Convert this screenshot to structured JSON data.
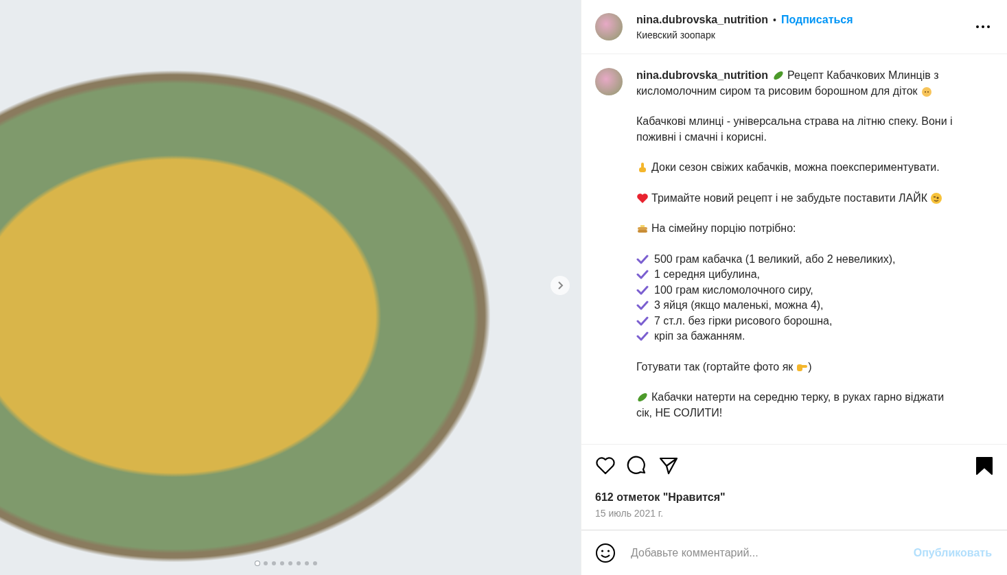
{
  "photo": {
    "dots": [
      {
        "selected": true
      },
      {
        "selected": false
      },
      {
        "selected": false
      },
      {
        "selected": false
      },
      {
        "selected": false
      },
      {
        "selected": false
      },
      {
        "selected": false
      },
      {
        "selected": false
      }
    ]
  },
  "header": {
    "username": "nina.dubrovska_nutrition",
    "separator": "•",
    "follow": "Подписаться",
    "location": "Киевский зоопарк"
  },
  "caption": {
    "username": "nina.dubrovska_nutrition",
    "blocks": [
      {
        "kind": "text",
        "lines": [
          "Рецепт Кабачкових Млинців з",
          "кисломолочним сиром та рисовим борошном для діток"
        ]
      },
      {
        "kind": "text",
        "lines": [
          "Кабачкові млинці - універсальна страва на літню спеку. Вони і поживні і смачні і корисні."
        ]
      },
      {
        "kind": "text",
        "lines": [
          "Доки сезон свіжих кабачків, можна поекспериментувати."
        ]
      },
      {
        "kind": "text",
        "lines": [
          "Тримайте новий рецепт і не забудьте поставити ЛАЙК"
        ]
      },
      {
        "kind": "text",
        "lines": [
          "На сімейну порцію потрібно:"
        ]
      },
      {
        "kind": "list",
        "items": [
          "500 грам кабачка (1 великий, або 2 невеликих),",
          "1 середня цибулина,",
          "100 грам кисломолочного сиру,",
          "3 яйця (якщо маленькі, можна 4),",
          "7 ст.л. без гірки рисового борошна,",
          "кріп за бажанням."
        ]
      },
      {
        "kind": "text",
        "lines": [
          "Готувати так (гортайте фото як"
        ],
        "tail": ")"
      },
      {
        "kind": "text",
        "lines": [
          "Кабачки натерти на середню терку, в руках гарно віджати",
          "сік, НЕ СОЛИТИ!"
        ]
      }
    ]
  },
  "actions": {
    "liked": false,
    "saved": true,
    "likes": "612 отметок \"Нравится\"",
    "date": "15 июль 2021 г."
  },
  "comment": {
    "placeholder": "Добавьте комментарий...",
    "post": "Опубликовать"
  }
}
